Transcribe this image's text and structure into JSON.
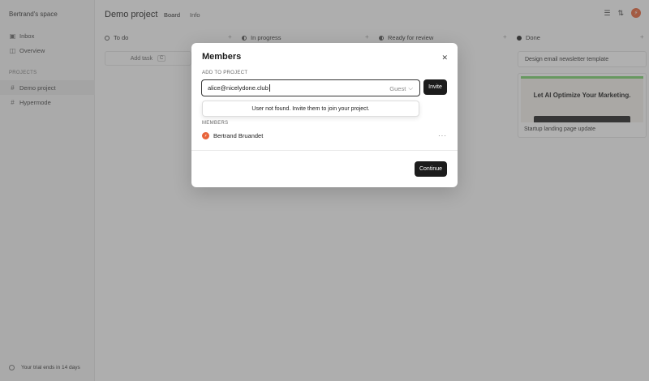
{
  "sidebar": {
    "workspace": "Bertrand's space",
    "items": [
      {
        "label": "Inbox",
        "icon": "inbox-icon"
      },
      {
        "label": "Overview",
        "icon": "overview-icon"
      }
    ],
    "projects_label": "PROJECTS",
    "projects": [
      {
        "label": "Demo project",
        "icon": "hash-icon",
        "active": true
      },
      {
        "label": "Hypermode",
        "icon": "hash-icon",
        "active": false
      }
    ],
    "trial": "Your trial ends in 14 days"
  },
  "header": {
    "title": "Demo project",
    "tabs": [
      {
        "label": "Board",
        "active": true
      },
      {
        "label": "Info",
        "active": false
      }
    ],
    "icons": [
      "filter-icon",
      "sort-icon",
      "avatar"
    ]
  },
  "board": {
    "columns": [
      {
        "label": "To do"
      },
      {
        "label": "In progress"
      },
      {
        "label": "Ready for review"
      },
      {
        "label": "Done"
      }
    ],
    "add_task": "Add task",
    "add_task_shortcut": "C",
    "done_cards": [
      {
        "title": "Design email newsletter template"
      },
      {
        "title": "Startup landing page update",
        "thumbnail_headline": "Let AI Optimize Your Marketing."
      }
    ]
  },
  "modal": {
    "title": "Members",
    "add_label": "ADD TO PROJECT",
    "input_value": "alice@nicelydone.club",
    "role": "Guest",
    "invite_label": "Invite",
    "not_found_text": "User not found. Invite them to join your project.",
    "members_label": "MEMBERS",
    "members": [
      {
        "name": "Bertrand Bruandet"
      }
    ],
    "continue_label": "Continue"
  },
  "colors": {
    "accent": "#1c1c1c",
    "avatar": "#e8643a"
  }
}
